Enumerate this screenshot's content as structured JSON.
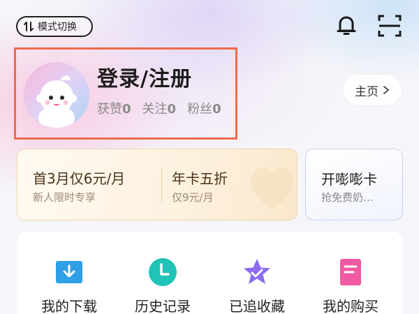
{
  "top_bar": {
    "mode_toggle_label": "模式切换"
  },
  "profile": {
    "login_label": "登录/注册",
    "stats": [
      {
        "label": "获赞",
        "value": "0"
      },
      {
        "label": "关注",
        "value": "0"
      },
      {
        "label": "粉丝",
        "value": "0"
      }
    ],
    "home_button_label": "主页",
    "highlight_color": "#ee6b4d"
  },
  "vip_card": {
    "offers": [
      {
        "title": "首3月仅6元/月",
        "subtitle": "新人限时专享"
      },
      {
        "title": "年卡五折",
        "subtitle": "仅9元/月"
      }
    ]
  },
  "side_card": {
    "title": "开嘭嘭卡",
    "subtitle": "抢免费奶…"
  },
  "shortcuts": [
    {
      "label": "我的下载",
      "icon": "download-icon",
      "color": "#2f9fe6"
    },
    {
      "label": "历史记录",
      "icon": "clock-icon",
      "color": "#1fc3b7"
    },
    {
      "label": "已追收藏",
      "icon": "star-icon",
      "color": "#8d6cf0"
    },
    {
      "label": "我的购买",
      "icon": "purchase-doc-icon",
      "color": "#f05aa0"
    }
  ]
}
